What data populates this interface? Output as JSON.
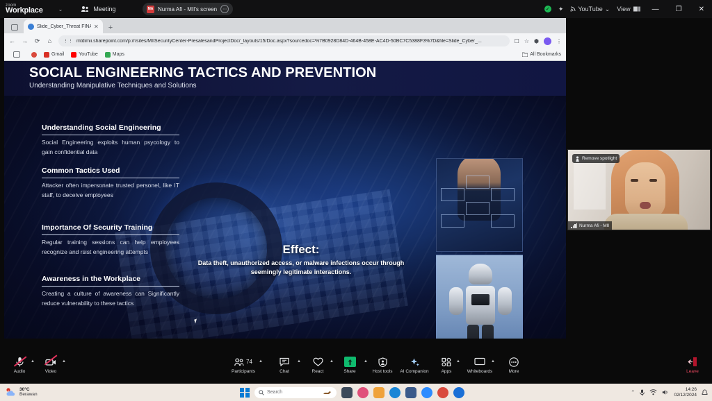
{
  "zoom_topbar": {
    "brand_small": "zoom",
    "brand_large": "Workplace",
    "caret": "⌄",
    "meeting_label": "Meeting",
    "share_pill": {
      "badge": "MA",
      "label": "Nurma Afi - MII's screen",
      "more_icon": "more-options-icon"
    },
    "right": {
      "shield_icon": "shield-check-icon",
      "sparkle_icon": "copilot-sparkle-icon",
      "youtube_label": "YouTube",
      "youtube_caret": "⌄",
      "view_label": "View",
      "minimize": "—",
      "maximize": "❐",
      "close": "✕"
    }
  },
  "browser": {
    "tab": {
      "title": "Slide_Cyber_Threat FINAL.p",
      "close": "✕"
    },
    "new_tab": "+",
    "nav": {
      "back": "←",
      "forward": "→",
      "reload": "⟳",
      "home": "⌂"
    },
    "omnibox": {
      "lock_icon": "site-settings-icon",
      "url": "mtdimii.sharepoint.com/p:/r/sites/MIISecurityCenter-PresalesandProjectDoc/_layouts/15/Doc.aspx?sourcedoc=%7B0928D84D-464B-458E-AC4D-50BC7C5388F3%7D&file=Slide_Cyber_...",
      "split_icon": "split-screen-icon",
      "star_icon": "bookmark-star-icon",
      "extensions_icon": "extensions-icon",
      "menu_icon": "kebab-menu-icon"
    },
    "bookmarks": {
      "apps_icon": "apps-grid-icon",
      "items": [
        {
          "label": "",
          "icon": "chrome-icon",
          "color": "#d94a3d"
        },
        {
          "label": "Gmail",
          "icon": "gmail-icon",
          "color": "#d93025"
        },
        {
          "label": "YouTube",
          "icon": "youtube-icon",
          "color": "#ff0000"
        },
        {
          "label": "Maps",
          "icon": "maps-icon",
          "color": "#34a853"
        }
      ],
      "all_bookmarks": "All Bookmarks"
    }
  },
  "slide": {
    "title": "SOCIAL ENGINEERING TACTICS AND PREVENTION",
    "subtitle": "Understanding Manipulative Techniques and Solutions",
    "bullets": [
      {
        "heading": "Understanding Social Engineering",
        "body": "Social Engineering exploits human psycology to gain confidential data"
      },
      {
        "heading": "Common Tactics Used",
        "body": "Attacker often impersonate trusted personel, like IT staff, to deceive employees"
      },
      {
        "heading": "Importance Of Security Training",
        "body": "Regular training sessions can help employees recognize and rsist engineering attempts"
      },
      {
        "heading": "Awareness in the Workplace",
        "body": "Creating a culture of awareness can Significantly reduce vulnerability to these tactics"
      }
    ],
    "effect": {
      "title": "Effect:",
      "body": "Data theft, unauthorized access, or malware infections occur through seemingly legitimate interactions."
    },
    "photos": [
      {
        "name": "hexagon-network-photo"
      },
      {
        "name": "humanoid-robot-photo"
      }
    ]
  },
  "video_tile": {
    "spotlight_badge": "Remove spotlight",
    "spotlight_icon": "spotlight-icon",
    "participant_name": "Nurma Afi - MII",
    "signal_icon": "network-signal-icon"
  },
  "zoom_toolbar": {
    "items": [
      {
        "id": "audio",
        "label": "Audio",
        "icon": "microphone-muted-icon",
        "muted": true,
        "caret": true
      },
      {
        "id": "video",
        "label": "Video",
        "icon": "camera-muted-icon",
        "muted": true,
        "caret": true
      },
      {
        "id": "participants",
        "label": "Participants",
        "icon": "people-icon",
        "count": "74",
        "caret": true
      },
      {
        "id": "chat",
        "label": "Chat",
        "icon": "chat-bubble-icon",
        "caret": true
      },
      {
        "id": "react",
        "label": "React",
        "icon": "heart-icon",
        "caret": true
      },
      {
        "id": "share",
        "label": "Share",
        "icon": "share-screen-icon",
        "active": true,
        "caret": true
      },
      {
        "id": "host-tools",
        "label": "Host tools",
        "icon": "shield-host-icon"
      },
      {
        "id": "ai-companion",
        "label": "AI Companion",
        "icon": "ai-sparkle-icon"
      },
      {
        "id": "apps",
        "label": "Apps",
        "icon": "apps-icon",
        "caret": true
      },
      {
        "id": "whiteboards",
        "label": "Whiteboards",
        "icon": "whiteboard-icon",
        "caret": true
      },
      {
        "id": "more",
        "label": "More",
        "icon": "more-ellipsis-icon"
      }
    ],
    "leave": {
      "label": "Leave",
      "icon": "leave-meeting-icon"
    }
  },
  "taskbar": {
    "weather": {
      "temperature": "30°C",
      "condition": "Berawan",
      "icon": "weather-cloud-icon"
    },
    "start_icon": "windows-start-icon",
    "search": {
      "placeholder": "Search",
      "icon": "search-icon",
      "doodle": "taskbar-doodle-icon"
    },
    "apps": [
      {
        "name": "task-view-icon",
        "color": "#3c4a5a"
      },
      {
        "name": "photos-icon",
        "color": "#e0507a"
      },
      {
        "name": "file-explorer-icon",
        "color": "#efa23a"
      },
      {
        "name": "edge-icon",
        "color": "#1a86d6"
      },
      {
        "name": "store-icon",
        "color": "#3b5a8a"
      },
      {
        "name": "zoom-icon",
        "color": "#2d8cff"
      },
      {
        "name": "chrome-icon",
        "color": "#d94a3d"
      },
      {
        "name": "outlook-icon",
        "color": "#1a6fd6"
      }
    ],
    "tray": {
      "chevron": "⌃",
      "mic_icon": "microphone-icon",
      "wifi_icon": "wifi-icon",
      "volume_icon": "speaker-icon",
      "time": "14:26",
      "date": "02/12/2024",
      "notification_icon": "notification-bell-icon"
    }
  },
  "colors": {
    "zoom_green": "#0fba6e",
    "mute_red": "#e0315b",
    "slide_bg": "#0d1940",
    "accent_blue": "#2d8cff"
  }
}
